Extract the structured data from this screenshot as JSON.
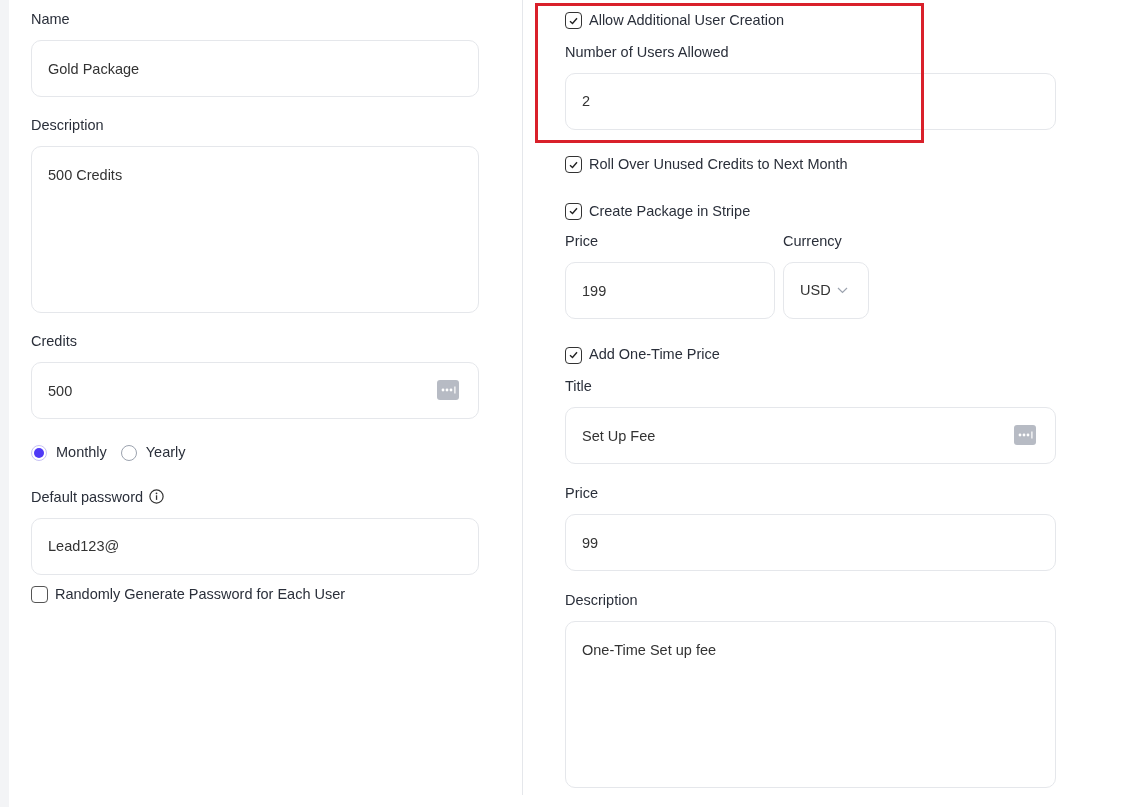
{
  "left": {
    "name": {
      "label": "Name",
      "value": "Gold Package"
    },
    "description": {
      "label": "Description",
      "value": "500 Credits"
    },
    "credits": {
      "label": "Credits",
      "value": "500"
    },
    "billing": [
      {
        "label": "Monthly",
        "selected": true
      },
      {
        "label": "Yearly",
        "selected": false
      }
    ],
    "password": {
      "label": "Default password",
      "value": "Lead123@"
    },
    "random_password": {
      "label": "Randomly Generate Password for Each User",
      "checked": false
    }
  },
  "right": {
    "allow_users": {
      "label": "Allow Additional User Creation",
      "checked": true
    },
    "users_allowed": {
      "label": "Number of Users Allowed",
      "value": "2"
    },
    "rollover": {
      "label": "Roll Over Unused Credits to Next Month",
      "checked": true
    },
    "stripe": {
      "label": "Create Package in Stripe",
      "checked": true
    },
    "price": {
      "label": "Price",
      "value": "199"
    },
    "currency": {
      "label": "Currency",
      "value": "USD"
    },
    "one_time": {
      "label": "Add One-Time Price",
      "checked": true
    },
    "title": {
      "label": "Title",
      "value": "Set Up Fee"
    },
    "one_time_price": {
      "label": "Price",
      "value": "99"
    },
    "one_time_description": {
      "label": "Description",
      "value": "One-Time Set up fee"
    }
  }
}
